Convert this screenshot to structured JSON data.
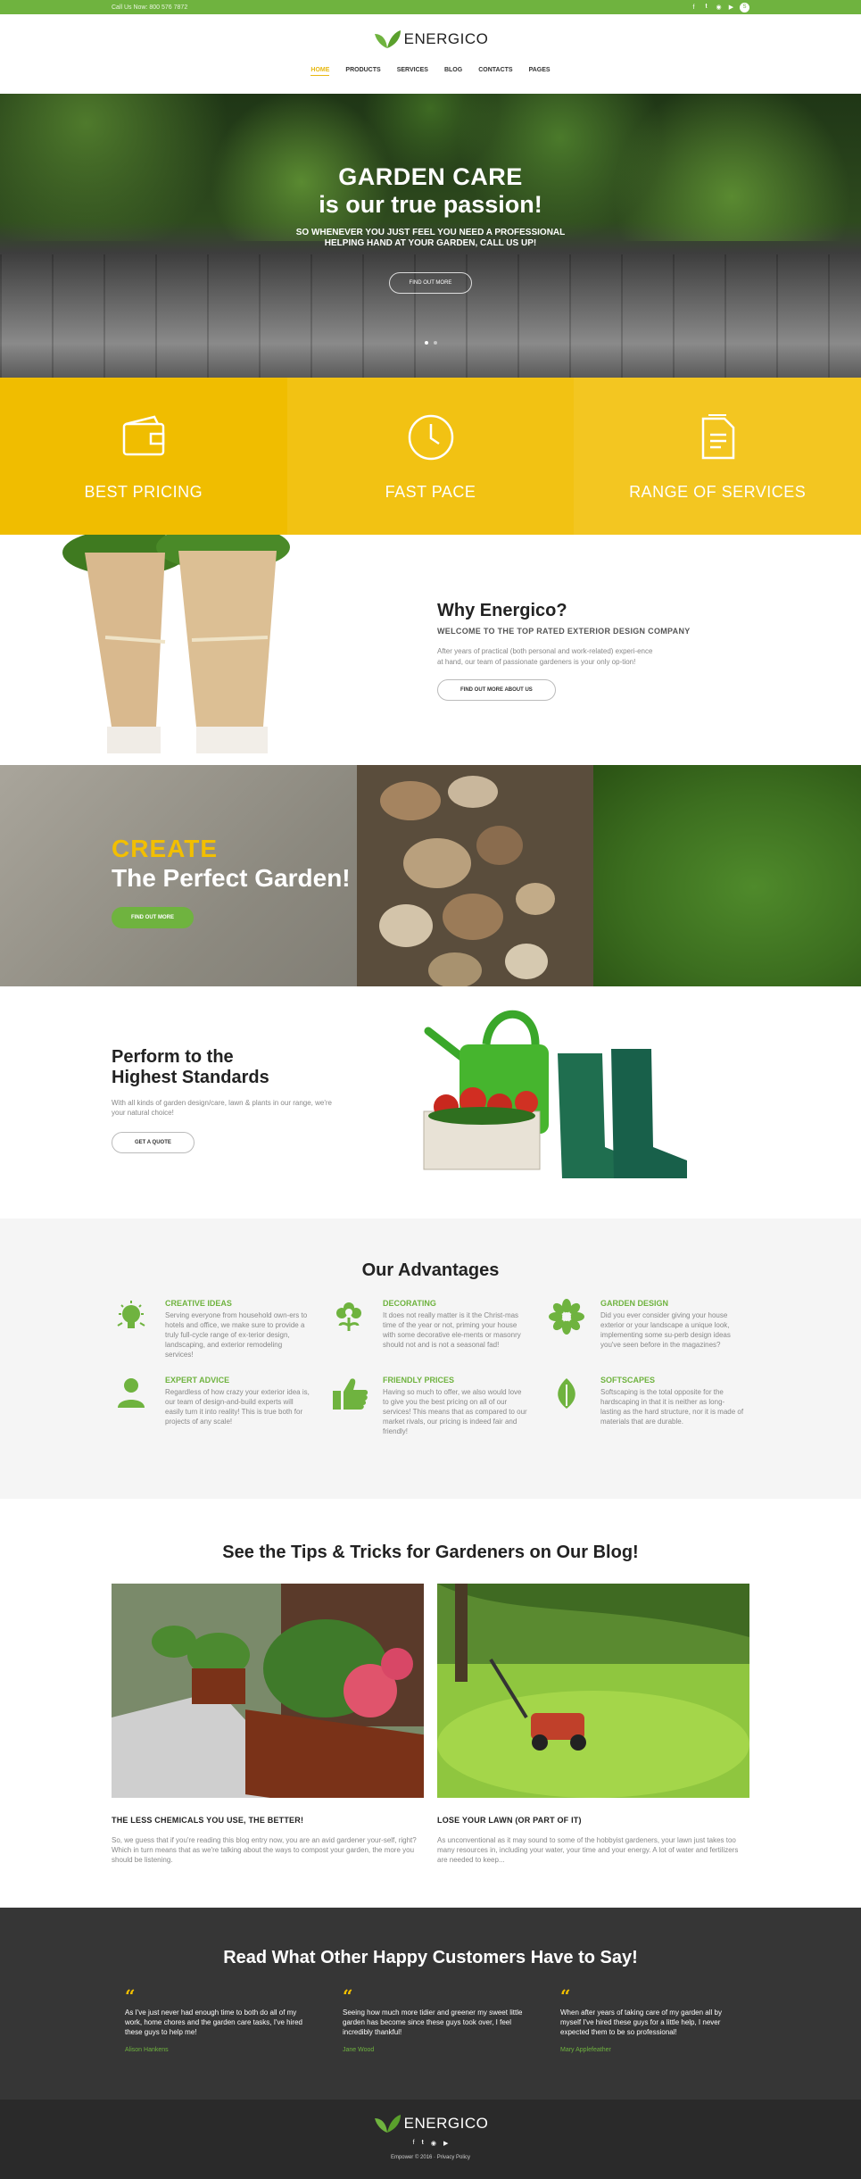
{
  "topbar": {
    "call": "Call Us Now: 800 576 7872",
    "social_icons": [
      "facebook-icon",
      "twitter-icon",
      "pinterest-icon",
      "youtube-icon",
      "skype-icon"
    ]
  },
  "brand": {
    "name": "ENERGICO"
  },
  "nav": [
    "HOME",
    "PRODUCTS",
    "SERVICES",
    "BLOG",
    "CONTACTS",
    "PAGES"
  ],
  "hero": {
    "line1": "GARDEN CARE",
    "line2": "is our true passion!",
    "sub": "SO WHENEVER YOU JUST FEEL YOU NEED A PROFESSIONAL HELPING HAND AT YOUR GARDEN, CALL US UP!",
    "button": "FIND OUT MORE"
  },
  "features": [
    {
      "label": "BEST PRICING",
      "icon": "wallet-icon",
      "color": "#f0bd00"
    },
    {
      "label": "FAST PACE",
      "icon": "clock-icon",
      "color": "#f2c213"
    },
    {
      "label": "RANGE OF SERVICES",
      "icon": "documents-icon",
      "color": "#f3c621"
    }
  ],
  "why": {
    "title": "Why Energico?",
    "subtitle": "WELCOME TO THE TOP RATED EXTERIOR DESIGN COMPANY",
    "text": "After years of practical (both personal and work-related) experi-ence at hand, our team of passionate gardeners is your only op-tion!",
    "button": "FIND OUT MORE ABOUT US"
  },
  "create": {
    "line1": "CREATE",
    "line2": "The Perfect Garden!",
    "button": "FIND OUT MORE"
  },
  "perform": {
    "title1": "Perform to the",
    "title2": "Highest Standards",
    "text": "With all kinds of garden design/care, lawn & plants in our range, we're your natural choice!",
    "button": "GET A QUOTE"
  },
  "advantages": {
    "title": "Our Advantages",
    "items": [
      {
        "title": "CREATIVE IDEAS",
        "icon": "bulb-icon",
        "text": "Serving everyone from household own-ers to hotels and office, we make sure to provide a truly full-cycle range of ex-terior design, landscaping, and exterior remodeling services!"
      },
      {
        "title": "DECORATING",
        "icon": "flower-icon",
        "text": "It does not really matter is it the Christ-mas time of the year or not, priming your house with some decorative ele-ments or masonry should not and is not a seasonal fad!"
      },
      {
        "title": "GARDEN DESIGN",
        "icon": "bloom-icon",
        "text": "Did you ever consider giving your house exterior or your landscape a unique look, implementing some su-perb design ideas you've seen before in the magazines?"
      },
      {
        "title": "EXPERT ADVICE",
        "icon": "person-icon",
        "text": "Regardless of how crazy your exterior idea is, our team of design-and-build experts will easily turn it into reality! This is true both for projects of any scale!"
      },
      {
        "title": "FRIENDLY PRICES",
        "icon": "thumbs-up-icon",
        "text": "Having so much to offer, we also would love to give you the best pricing on all of our services! This means that as compared to our market rivals, our pricing is indeed fair and friendly!"
      },
      {
        "title": "SOFTSCAPES",
        "icon": "leaf-icon",
        "text": "Softscaping is the total opposite for the hardscaping in that it is neither as long-lasting as the hard structure, nor it is made of materials that are durable."
      }
    ]
  },
  "blog": {
    "title": "See the Tips & Tricks for Gardeners on Our Blog!",
    "posts": [
      {
        "title": "THE LESS CHEMICALS YOU USE, THE BETTER!",
        "text": "So, we guess that if you're reading this blog entry now, you are an avid gardener your-self, right? Which in turn means that as we're talking about the ways to compost your garden, the more you should be listening."
      },
      {
        "title": "LOSE YOUR LAWN (OR PART OF IT)",
        "text": "As unconventional as it may sound to some of the hobbyist gardeners, your lawn just takes too many resources in, including your water, your time and your energy. A lot of water and fertilizers are needed to keep..."
      }
    ]
  },
  "testimonials": {
    "title": "Read What Other Happy Customers Have to Say!",
    "items": [
      {
        "text": "As I've just never had enough time to both do all of my work, home chores and the garden care tasks, I've hired these guys to help me!",
        "author": "Alison Hankens"
      },
      {
        "text": "Seeing how much more tidier and greener my sweet little garden has become since these guys took over, I feel incredibly thankful!",
        "author": "Jane Wood"
      },
      {
        "text": "When after years of taking care of my garden all by myself I've hired these guys for a little help, I never expected them to be so professional!",
        "author": "Mary Applefeather"
      }
    ]
  },
  "footer": {
    "copyright": "Empower © 2016 · Privacy Policy"
  }
}
